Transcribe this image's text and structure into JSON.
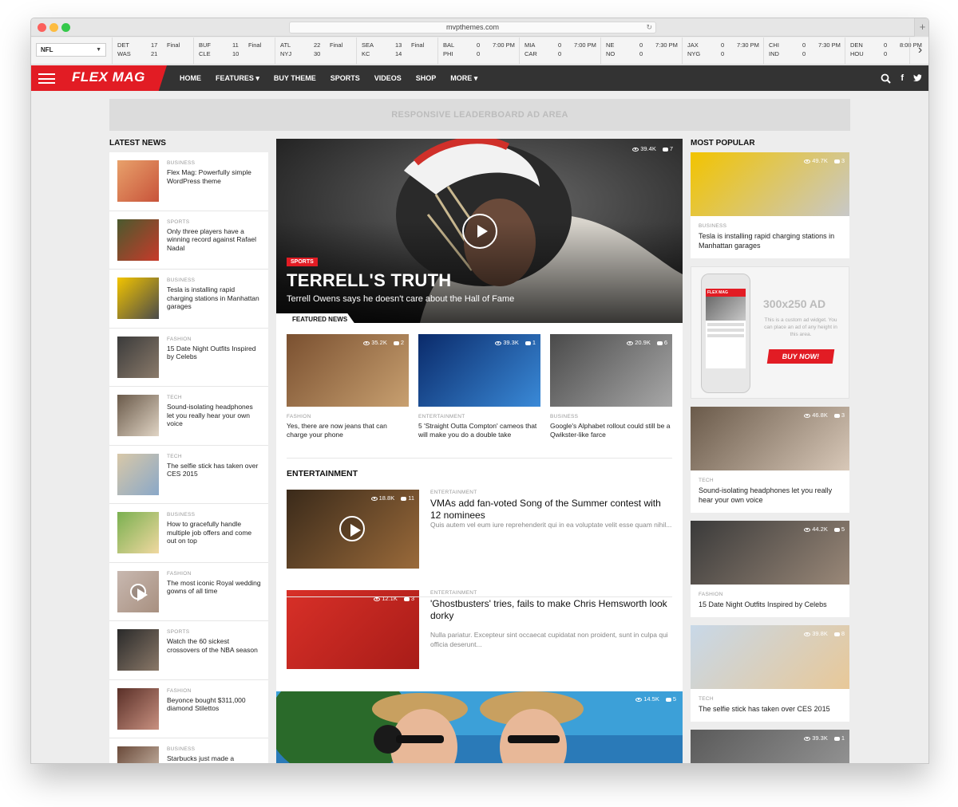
{
  "browser": {
    "url": "mvpthemes.com",
    "reload_icon": "reload-icon",
    "newtab_symbol": "+"
  },
  "scoreboard": {
    "league": "NFL",
    "games": [
      {
        "t1": "DET",
        "s1": "17",
        "t2": "WAS",
        "s2": "21",
        "status": "Final"
      },
      {
        "t1": "BUF",
        "s1": "11",
        "t2": "CLE",
        "s2": "10",
        "status": "Final"
      },
      {
        "t1": "ATL",
        "s1": "22",
        "t2": "NYJ",
        "s2": "30",
        "status": "Final"
      },
      {
        "t1": "SEA",
        "s1": "13",
        "t2": "KC",
        "s2": "14",
        "status": "Final"
      },
      {
        "t1": "BAL",
        "s1": "0",
        "t2": "PHI",
        "s2": "0",
        "status": "7:00 PM"
      },
      {
        "t1": "MIA",
        "s1": "0",
        "t2": "CAR",
        "s2": "0",
        "status": "7:00 PM"
      },
      {
        "t1": "NE",
        "s1": "0",
        "t2": "NO",
        "s2": "0",
        "status": "7:30 PM"
      },
      {
        "t1": "JAX",
        "s1": "0",
        "t2": "NYG",
        "s2": "0",
        "status": "7:30 PM"
      },
      {
        "t1": "CHI",
        "s1": "0",
        "t2": "IND",
        "s2": "0",
        "status": "7:30 PM"
      },
      {
        "t1": "DEN",
        "s1": "0",
        "t2": "HOU",
        "s2": "0",
        "status": "8:00 PM"
      }
    ]
  },
  "nav": {
    "logo": "FLEX MAG",
    "items": [
      "HOME",
      "FEATURES ▾",
      "BUY THEME",
      "SPORTS",
      "VIDEOS",
      "SHOP",
      "MORE ▾"
    ]
  },
  "ad_banner": "RESPONSIVE LEADERBOARD AD AREA",
  "left": {
    "title": "LATEST NEWS",
    "items": [
      {
        "cat": "BUSINESS",
        "title": "Flex Mag: Powerfully simple WordPress theme",
        "c1": "#e8a16b",
        "c2": "#c8533a"
      },
      {
        "cat": "SPORTS",
        "title": "Only three players have a winning record against Rafael Nadal",
        "c1": "#4a5a2e",
        "c2": "#c83a2a"
      },
      {
        "cat": "BUSINESS",
        "title": "Tesla is installing rapid charging stations in Manhattan garages",
        "c1": "#f2c400",
        "c2": "#4a4a4a"
      },
      {
        "cat": "FASHION",
        "title": "15 Date Night Outfits Inspired by Celebs",
        "c1": "#3b3b3b",
        "c2": "#8a7a6a"
      },
      {
        "cat": "TECH",
        "title": "Sound-isolating headphones let you really hear your own voice",
        "c1": "#6a5a4a",
        "c2": "#e0d4c4"
      },
      {
        "cat": "TECH",
        "title": "The selfie stick has taken over CES 2015",
        "c1": "#d8c8a8",
        "c2": "#8aa8c8"
      },
      {
        "cat": "BUSINESS",
        "title": "How to gracefully handle multiple job offers and come out on top",
        "c1": "#7ab050",
        "c2": "#f0d8a0"
      },
      {
        "cat": "FASHION",
        "title": "The most iconic Royal wedding gowns of all time",
        "c1": "#c8b8b0",
        "c2": "#a89080"
      },
      {
        "cat": "SPORTS",
        "title": "Watch the 60 sickest crossovers of the NBA season",
        "c1": "#2a2a2a",
        "c2": "#8a7868"
      },
      {
        "cat": "FASHION",
        "title": "Beyonce bought $311,000 diamond Stilettos",
        "c1": "#5a3028",
        "c2": "#c89080"
      },
      {
        "cat": "BUSINESS",
        "title": "Starbucks just made a",
        "c1": "#6a4a3a",
        "c2": "#d8c8b8"
      }
    ]
  },
  "hero": {
    "views": "39.4K",
    "comments": "7",
    "badge": "SPORTS",
    "title": "TERRELL'S TRUTH",
    "subtitle": "Terrell Owens says he doesn't care about the Hall of Fame",
    "featured_tab": "FEATURED NEWS"
  },
  "featured": [
    {
      "views": "35.2K",
      "comments": "2",
      "cat": "FASHION",
      "title": "Yes, there are now jeans that can charge your phone",
      "c1": "#7a5030",
      "c2": "#c8a070"
    },
    {
      "views": "39.3K",
      "comments": "1",
      "cat": "ENTERTAINMENT",
      "title": "5 'Straight Outta Compton' cameos that will make you do a double take",
      "c1": "#0a2a6a",
      "c2": "#3a8ad8"
    },
    {
      "views": "20.9K",
      "comments": "6",
      "cat": "BUSINESS",
      "title": "Google's Alphabet rollout could still be a Qwikster-like farce",
      "c1": "#4a4a4a",
      "c2": "#a8a8a8"
    }
  ],
  "entertainment": {
    "title": "ENTERTAINMENT",
    "items": [
      {
        "views": "18.8K",
        "comments": "11",
        "cat": "ENTERTAINMENT",
        "title": "VMAs add fan-voted Song of the Summer contest with 12 nominees",
        "excerpt": "Quis autem vel eum iure reprehenderit qui in ea voluptate velit esse quam nihil...",
        "c1": "#3a2a1a",
        "c2": "#9a6a3a"
      },
      {
        "views": "12.1K",
        "comments": "3",
        "cat": "ENTERTAINMENT",
        "title": "'Ghostbusters' tries, fails to make Chris Hemsworth look dorky",
        "excerpt": "Nulla pariatur. Excepteur sint occaecat cupidatat non proident, sunt in culpa qui officia deserunt...",
        "c1": "#d83028",
        "c2": "#a81c18"
      }
    ]
  },
  "bottom_stats": {
    "views": "14.5K",
    "comments": "5"
  },
  "right": {
    "title": "MOST POPULAR",
    "cards": [
      {
        "views": "49.7K",
        "comments": "3",
        "cat": "BUSINESS",
        "title": "Tesla is installing rapid charging stations in Manhattan garages",
        "c1": "#f2c400",
        "c2": "#c8c8c8"
      },
      {
        "views": "46.8K",
        "comments": "3",
        "cat": "TECH",
        "title": "Sound-isolating headphones let you really hear your own voice",
        "c1": "#6a5a4a",
        "c2": "#d8c8b8"
      },
      {
        "views": "44.2K",
        "comments": "5",
        "cat": "FASHION",
        "title": "15 Date Night Outfits Inspired by Celebs",
        "c1": "#3a3a3a",
        "c2": "#9a8878"
      },
      {
        "views": "39.8K",
        "comments": "8",
        "cat": "TECH",
        "title": "The selfie stick has taken over CES 2015",
        "c1": "#c8d8e8",
        "c2": "#e8c898"
      },
      {
        "views": "39.3K",
        "comments": "1"
      }
    ],
    "ad": {
      "size": "300x250 AD",
      "text": "This is a custom ad widget. You can place an ad of any height in this area.",
      "button": "BUY NOW!",
      "phone_logo": "FLEX MAG"
    }
  },
  "colors": {
    "brand_red": "#e21c24",
    "nav_bg": "#333333"
  }
}
